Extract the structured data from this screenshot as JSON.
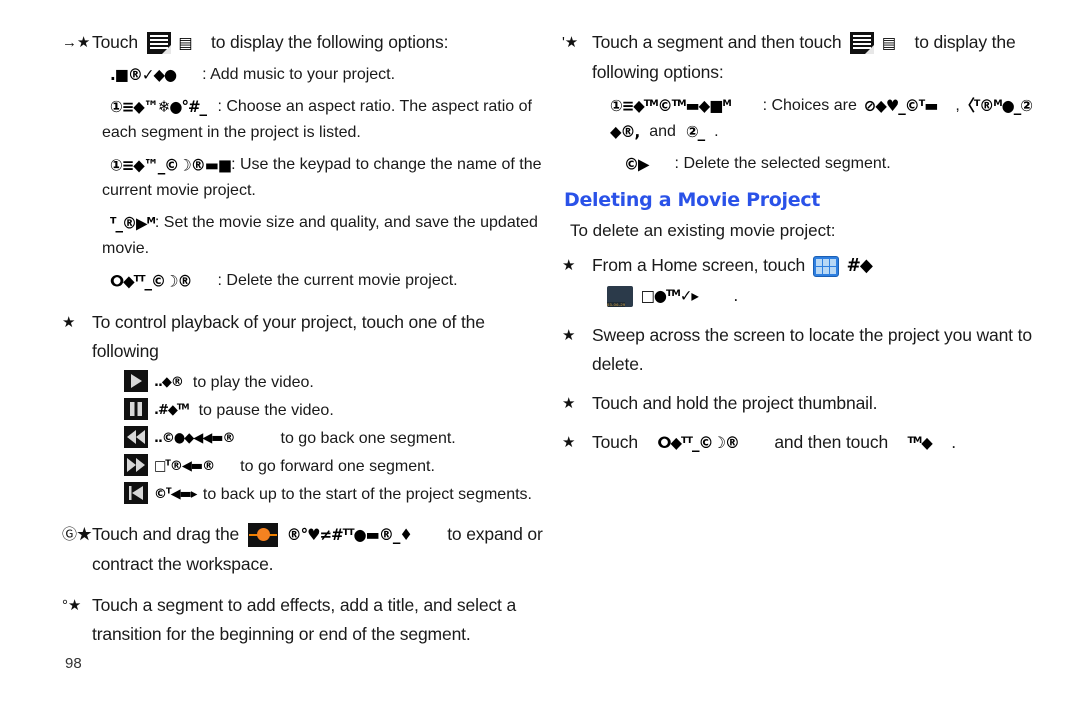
{
  "document": {
    "page_number": "98",
    "heading_color": "#2a52e8",
    "background_color": "#ffffff"
  },
  "left_column": {
    "b1": {
      "marker": "→★",
      "text_before": "Touch",
      "garbled_icon": "▤",
      "text_after": "to display the following options:"
    },
    "b1_items": [
      {
        "garbled": ".■®✓◆●",
        "desc": ": Add music to your project."
      },
      {
        "garbled": "①≡◆™❄●°#_",
        "desc": ": Choose an aspect ratio. The aspect ratio of",
        "cont": "each segment in the project is listed."
      },
      {
        "garbled": "①≡◆™_©☽®▬■",
        "desc": ": Use the keypad to change the name of the",
        "cont": "current movie project."
      },
      {
        "garbled": "ᵀ_®▶ᴹ",
        "desc": ": Set the movie size and quality, and save the updated",
        "cont": "movie."
      },
      {
        "garbled": "ⵔ◆ᵀᵀ_©☽®",
        "desc": ": Delete the current movie project."
      }
    ],
    "b2": {
      "marker": "★",
      "line1": "To control playback of your project, touch one of the",
      "line2": "following"
    },
    "transport": [
      {
        "icon": "play-icon",
        "garbled": "..◆®",
        "desc": "to play the video."
      },
      {
        "icon": "pause-icon",
        "garbled": ".#◆ᵀᴹ",
        "desc": "to pause the video."
      },
      {
        "icon": "rewind-icon",
        "garbled": "..©●◆◀◀▬®",
        "desc": "to go back one segment."
      },
      {
        "icon": "fast-forward-icon",
        "garbled": "□ᵀ®◀▬®",
        "desc": "to go forward one segment."
      },
      {
        "icon": "skip-to-start-icon",
        "garbled": "©ᵀ◀▬▸",
        "desc": "to back up to the start of the project segments."
      }
    ],
    "b3": {
      "marker": "Ⓖ★",
      "text_before": "Touch and drag the",
      "garbled": "®°♥≠#ᵀᵀ●▬®_♦",
      "text_after": "to expand or",
      "line2": "contract the workspace."
    },
    "b4": {
      "marker": "°★",
      "line1": "Touch a segment to add effects, add a title, and select a",
      "line2": "transition for the beginning or end of the segment."
    }
  },
  "right_column": {
    "b1": {
      "marker": "'★",
      "text_before": "Touch a segment and then touch",
      "text_after": "to display the",
      "line2": "following options:"
    },
    "b1_items": [
      {
        "garbled": "①≡◆ᵀᴹ©ᵀᴹ▬◆■ᴹ",
        "desc": ": Choices are",
        "choice1": "⊘◆♥_©ᵀ▬",
        "sep": ",",
        "choice2": "〈ᵀ®ᴹ●_②",
        "cont_pre": "◆®,",
        "cont_and": "and",
        "cont_post": "②_",
        "cont_end": "."
      },
      {
        "garbled": "©▶",
        "desc": ": Delete the selected segment."
      }
    ],
    "heading": "Deleting a Movie Project",
    "intro": "To delete an existing movie project:",
    "steps": [
      {
        "marker": "★",
        "text_before": "From a Home screen, touch",
        "icon": "apps-grid-icon",
        "garbled_after": "#◆",
        "line2_icon": "movie-studio-icon",
        "line2_garbled": "□●ᵀᴹ✓▸",
        "line2_end": "."
      },
      {
        "marker": "★",
        "line1": "Sweep across the screen to locate the project you want to",
        "line2": "delete."
      },
      {
        "marker": "★",
        "line1": "Touch and hold the project thumbnail."
      },
      {
        "marker": "★",
        "text_before": "Touch",
        "garbled1": "ⵔ◆ᵀᵀ_©☽®",
        "text_mid": "and then touch",
        "garbled2": "ᵀᴹ◆",
        "text_end": "."
      }
    ]
  }
}
